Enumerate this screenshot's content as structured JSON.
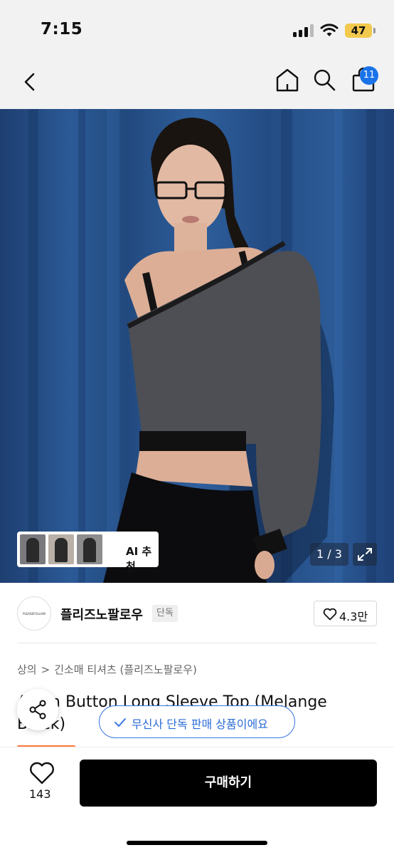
{
  "status_bar": {
    "time": "7:15",
    "battery": "47"
  },
  "nav": {
    "cart_count": "11"
  },
  "gallery": {
    "ai_label": "AI 추천",
    "pager": "1 / 3"
  },
  "brand": {
    "logo_text": "PLEASEFOLLOW",
    "name": "플리즈노팔로우",
    "tag": "단독"
  },
  "like": {
    "count": "4.3만"
  },
  "breadcrumb": {
    "category": "상의",
    "subcategory": "긴소매 티셔츠 (플리즈노팔로우)"
  },
  "product": {
    "title": "Asym Button Long Sleeve Top (Melange Black)"
  },
  "toast": {
    "text": "무신사 단독 판매 상품이에요"
  },
  "bottom": {
    "wish_count": "143",
    "buy_label": "구매하기"
  },
  "colors": {
    "accent_blue": "#3a78e0",
    "badge_blue": "#1a73e8",
    "buy_button": "#000000",
    "promo_orange": "#ff7a3d"
  }
}
